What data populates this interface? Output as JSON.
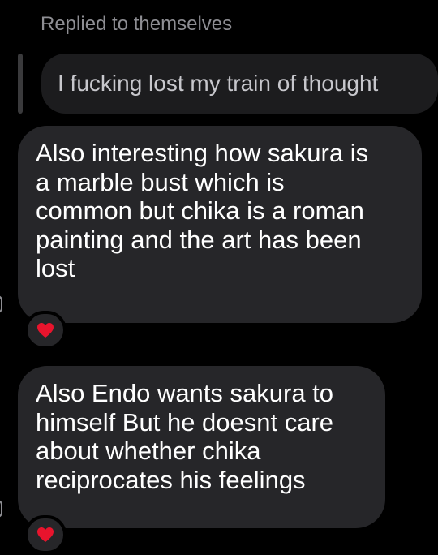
{
  "reply": {
    "header": "Replied to themselves",
    "quoted_text": "I fucking lost my train of thought"
  },
  "messages": [
    {
      "lines": [
        "Also interesting how sakura is",
        "a marble bust which is",
        "common but chika is a roman",
        "painting and the art has been",
        "lost"
      ],
      "reaction": "red-heart-icon"
    },
    {
      "lines": [
        "Also Endo wants sakura to",
        "himself But he doesnt care",
        "about whether chika",
        "reciprocates his feelings"
      ],
      "reaction": "red-heart-icon"
    }
  ],
  "colors": {
    "background": "#000000",
    "bubble": "#262629",
    "quoted_bubble": "#1c1c1e",
    "muted_text": "#8e8e93",
    "heart": "#e8142d"
  }
}
